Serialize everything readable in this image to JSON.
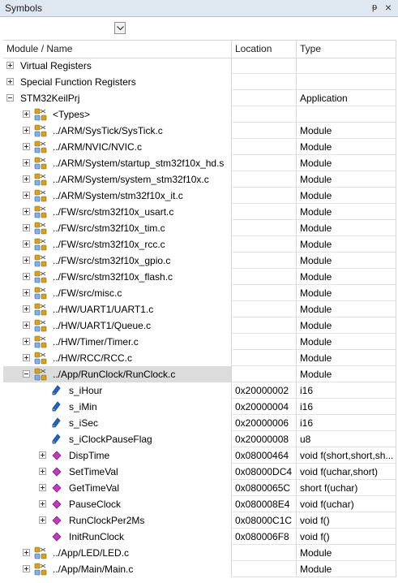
{
  "window": {
    "title": "Symbols",
    "pin_glyph": "ᵽ",
    "close_glyph": "×"
  },
  "columns": {
    "name": "Module / Name",
    "location": "Location",
    "type": "Type"
  },
  "rows": [
    {
      "level": 0,
      "expander": "plus",
      "icon": "none",
      "name": "Virtual Registers",
      "location": "",
      "type": ""
    },
    {
      "level": 0,
      "expander": "plus",
      "icon": "none",
      "name": "Special Function Registers",
      "location": "",
      "type": ""
    },
    {
      "level": 0,
      "expander": "minus",
      "icon": "none",
      "name": "STM32KeilPrj",
      "location": "",
      "type": "Application"
    },
    {
      "level": 1,
      "expander": "plus",
      "icon": "module",
      "name": "<Types>",
      "location": "",
      "type": ""
    },
    {
      "level": 1,
      "expander": "plus",
      "icon": "module",
      "name": "../ARM/SysTick/SysTick.c",
      "location": "",
      "type": "Module"
    },
    {
      "level": 1,
      "expander": "plus",
      "icon": "module",
      "name": "../ARM/NVIC/NVIC.c",
      "location": "",
      "type": "Module"
    },
    {
      "level": 1,
      "expander": "plus",
      "icon": "module",
      "name": "../ARM/System/startup_stm32f10x_hd.s",
      "location": "",
      "type": "Module"
    },
    {
      "level": 1,
      "expander": "plus",
      "icon": "module",
      "name": "../ARM/System/system_stm32f10x.c",
      "location": "",
      "type": "Module"
    },
    {
      "level": 1,
      "expander": "plus",
      "icon": "module",
      "name": "../ARM/System/stm32f10x_it.c",
      "location": "",
      "type": "Module"
    },
    {
      "level": 1,
      "expander": "plus",
      "icon": "module",
      "name": "../FW/src/stm32f10x_usart.c",
      "location": "",
      "type": "Module"
    },
    {
      "level": 1,
      "expander": "plus",
      "icon": "module",
      "name": "../FW/src/stm32f10x_tim.c",
      "location": "",
      "type": "Module"
    },
    {
      "level": 1,
      "expander": "plus",
      "icon": "module",
      "name": "../FW/src/stm32f10x_rcc.c",
      "location": "",
      "type": "Module"
    },
    {
      "level": 1,
      "expander": "plus",
      "icon": "module",
      "name": "../FW/src/stm32f10x_gpio.c",
      "location": "",
      "type": "Module"
    },
    {
      "level": 1,
      "expander": "plus",
      "icon": "module",
      "name": "../FW/src/stm32f10x_flash.c",
      "location": "",
      "type": "Module"
    },
    {
      "level": 1,
      "expander": "plus",
      "icon": "module",
      "name": "../FW/src/misc.c",
      "location": "",
      "type": "Module"
    },
    {
      "level": 1,
      "expander": "plus",
      "icon": "module",
      "name": "../HW/UART1/UART1.c",
      "location": "",
      "type": "Module"
    },
    {
      "level": 1,
      "expander": "plus",
      "icon": "module",
      "name": "../HW/UART1/Queue.c",
      "location": "",
      "type": "Module"
    },
    {
      "level": 1,
      "expander": "plus",
      "icon": "module",
      "name": "../HW/Timer/Timer.c",
      "location": "",
      "type": "Module"
    },
    {
      "level": 1,
      "expander": "plus",
      "icon": "module",
      "name": "../HW/RCC/RCC.c",
      "location": "",
      "type": "Module"
    },
    {
      "level": 1,
      "expander": "minus",
      "icon": "module",
      "name": "../App/RunClock/RunClock.c",
      "location": "",
      "type": "Module",
      "selected": true
    },
    {
      "level": 2,
      "expander": "none",
      "icon": "variable",
      "name": "s_iHour",
      "location": "0x20000002",
      "type": "i16"
    },
    {
      "level": 2,
      "expander": "none",
      "icon": "variable",
      "name": "s_iMin",
      "location": "0x20000004",
      "type": "i16"
    },
    {
      "level": 2,
      "expander": "none",
      "icon": "variable",
      "name": "s_iSec",
      "location": "0x20000006",
      "type": "i16"
    },
    {
      "level": 2,
      "expander": "none",
      "icon": "variable",
      "name": "s_iClockPauseFlag",
      "location": "0x20000008",
      "type": "u8"
    },
    {
      "level": 2,
      "expander": "plus",
      "icon": "function",
      "name": "DispTime",
      "location": "0x08000464",
      "type": "void f(short,short,sh..."
    },
    {
      "level": 2,
      "expander": "plus",
      "icon": "function",
      "name": "SetTimeVal",
      "location": "0x08000DC4",
      "type": "void f(uchar,short)"
    },
    {
      "level": 2,
      "expander": "plus",
      "icon": "function",
      "name": "GetTimeVal",
      "location": "0x0800065C",
      "type": "short f(uchar)"
    },
    {
      "level": 2,
      "expander": "plus",
      "icon": "function",
      "name": "PauseClock",
      "location": "0x080008E4",
      "type": "void f(uchar)"
    },
    {
      "level": 2,
      "expander": "plus",
      "icon": "function",
      "name": "RunClockPer2Ms",
      "location": "0x08000C1C",
      "type": "void f()"
    },
    {
      "level": 2,
      "expander": "none",
      "icon": "function",
      "name": "InitRunClock",
      "location": "0x080006F8",
      "type": "void f()"
    },
    {
      "level": 1,
      "expander": "plus",
      "icon": "module",
      "name": "../App/LED/LED.c",
      "location": "",
      "type": "Module"
    },
    {
      "level": 1,
      "expander": "plus",
      "icon": "module",
      "name": "../App/Main/Main.c",
      "location": "",
      "type": "Module"
    }
  ],
  "colors": {
    "titlebar": "#dfe7f1",
    "selection": "#dcdcdc",
    "variable_icon": "#1f66c9",
    "function_icon": "#c13bbd",
    "module_icon": "#d9a21a"
  }
}
